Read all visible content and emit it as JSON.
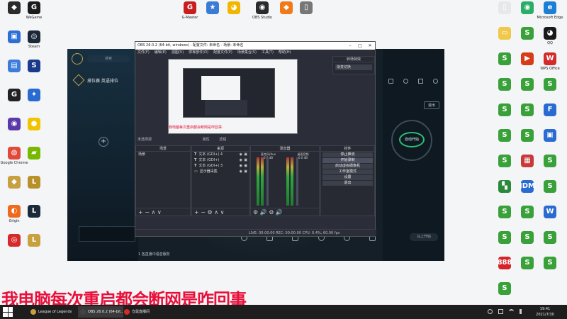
{
  "desktop": {
    "left_icons": [
      {
        "label": "",
        "color": "#2b2b2b",
        "glyph": "◆"
      },
      {
        "label": "WeGame",
        "color": "#1b1b1b",
        "glyph": "G"
      },
      {
        "label": "",
        "color": "#2c6fd6",
        "glyph": "▣"
      },
      {
        "label": "Steam",
        "color": "#1b2838",
        "glyph": "◎"
      },
      {
        "label": "",
        "color": "#3b7dd8",
        "glyph": "▤"
      },
      {
        "label": "",
        "color": "#1a3a8a",
        "glyph": "S"
      },
      {
        "label": "",
        "color": "#222222",
        "glyph": "G"
      },
      {
        "label": "",
        "color": "#2a6bd1",
        "glyph": "✦"
      },
      {
        "label": "",
        "color": "#5a3aa8",
        "glyph": "◉"
      },
      {
        "label": "",
        "color": "#f0c400",
        "glyph": "●"
      },
      {
        "label": "Google Chrome",
        "color": "#e04a3a",
        "glyph": "◍"
      },
      {
        "label": "",
        "color": "#76b900",
        "glyph": "▰"
      },
      {
        "label": "",
        "color": "#c8a040",
        "glyph": "◆"
      },
      {
        "label": "",
        "color": "#b8902a",
        "glyph": "L"
      },
      {
        "label": "Origin",
        "color": "#f06a1e",
        "glyph": "◐"
      },
      {
        "label": "",
        "color": "#1b2a3a",
        "glyph": "L"
      },
      {
        "label": "",
        "color": "#d42a2a",
        "glyph": "◎"
      },
      {
        "label": "",
        "color": "#c8a040",
        "glyph": "L"
      }
    ],
    "top_icons": [
      {
        "label": "G-Master",
        "color": "#c81e1e",
        "glyph": "G"
      },
      {
        "label": "",
        "color": "#3a7bd5",
        "glyph": "★"
      },
      {
        "label": "",
        "color": "#f2b600",
        "glyph": "◕"
      },
      {
        "label": "OBS Studio",
        "color": "#2b2b2b",
        "glyph": "◉"
      },
      {
        "label": "",
        "color": "#f07a1a",
        "glyph": "◆"
      },
      {
        "label": "",
        "color": "#777777",
        "glyph": "▯"
      }
    ],
    "right_icons": [
      {
        "label": "",
        "color": "#e8e8e8",
        "glyph": "▯"
      },
      {
        "label": "",
        "color": "#2aae67",
        "glyph": "◉"
      },
      {
        "label": "Microsoft Edge",
        "color": "#1b7fd6",
        "glyph": "e"
      },
      {
        "label": "",
        "color": "#f0c84a",
        "glyph": "▭"
      },
      {
        "label": "",
        "color": "#3aa13a",
        "glyph": "S"
      },
      {
        "label": "QQ",
        "color": "#1a1a1a",
        "glyph": "◕"
      },
      {
        "label": "",
        "color": "#3aa13a",
        "glyph": "S"
      },
      {
        "label": "",
        "color": "#d83a1a",
        "glyph": "▶"
      },
      {
        "label": "WPS Office",
        "color": "#d42a2a",
        "glyph": "W"
      },
      {
        "label": "",
        "color": "#3aa13a",
        "glyph": "S"
      },
      {
        "label": "",
        "color": "#3aa13a",
        "glyph": "S"
      },
      {
        "label": "",
        "color": "#3aa13a",
        "glyph": "S"
      },
      {
        "label": "",
        "color": "#3aa13a",
        "glyph": "S"
      },
      {
        "label": "",
        "color": "#3aa13a",
        "glyph": "S"
      },
      {
        "label": "",
        "color": "#2a6bd1",
        "glyph": "F"
      },
      {
        "label": "",
        "color": "#3aa13a",
        "glyph": "S"
      },
      {
        "label": "",
        "color": "#3aa13a",
        "glyph": "S"
      },
      {
        "label": "",
        "color": "#2a6bd1",
        "glyph": "▣"
      },
      {
        "label": "",
        "color": "#3aa13a",
        "glyph": "S"
      },
      {
        "label": "",
        "color": "#c83a3a",
        "glyph": "▦"
      },
      {
        "label": "",
        "color": "#3aa13a",
        "glyph": "S"
      },
      {
        "label": "",
        "color": "#2a8a3a",
        "glyph": "▚"
      },
      {
        "label": "",
        "color": "#2a6bd1",
        "glyph": "JDM"
      },
      {
        "label": "",
        "color": "#3aa13a",
        "glyph": "S"
      },
      {
        "label": "",
        "color": "#3aa13a",
        "glyph": "S"
      },
      {
        "label": "",
        "color": "#3aa13a",
        "glyph": "S"
      },
      {
        "label": "",
        "color": "#2a6bd1",
        "glyph": "W"
      },
      {
        "label": "",
        "color": "#3aa13a",
        "glyph": "S"
      },
      {
        "label": "",
        "color": "#3aa13a",
        "glyph": "S"
      },
      {
        "label": "",
        "color": "#3aa13a",
        "glyph": "S"
      },
      {
        "label": "",
        "color": "#d4242a",
        "glyph": "888"
      },
      {
        "label": "",
        "color": "#3aa13a",
        "glyph": "S"
      },
      {
        "label": "",
        "color": "#3aa13a",
        "glyph": "S"
      },
      {
        "label": "",
        "color": "#3aa13a",
        "glyph": "S"
      }
    ]
  },
  "game_client": {
    "search_placeholder": "搜索",
    "mode_title": "排位赛 英语排位",
    "exit_label": "退出",
    "start_label": "自动开始",
    "bottom_hint": "1 各直播中语音服务",
    "bottom_left_buttons": [
      "",
      "",
      ""
    ],
    "bottom_actions": [
      "直播间",
      "",
      "",
      "",
      "",
      ""
    ],
    "right_action": "马上开始"
  },
  "obs": {
    "window_title": "OBS 26.0.2 (64-bit, windows) - 配置文件: 未命名 - 场景: 未命名",
    "menu": [
      "文件(F)",
      "编辑(E)",
      "视图(V)",
      "停靠部件(D)",
      "配置文件(P)",
      "场景集合(S)",
      "工具(T)",
      "帮助(H)"
    ],
    "transition_title": "转场特效",
    "transition_value": "渐变切换",
    "preview_caption": "我电脑每次重启都会断网是咋回事",
    "source_name": "未选择源",
    "properties_label": "属性",
    "filters_label": "滤镜",
    "docks": {
      "scenes_title": "场景",
      "sources_title": "来源",
      "mixer_title": "混音器",
      "controls_title": "控件"
    },
    "scenes": [
      "场景"
    ],
    "sources": [
      {
        "icon": "T",
        "name": "文本 (GDI+) 4"
      },
      {
        "icon": "T",
        "name": "文本 (GDI+)"
      },
      {
        "icon": "T",
        "name": "文本 (GDI+) 3"
      },
      {
        "icon": "▭",
        "name": "显示器采集"
      }
    ],
    "mixer_channels": [
      {
        "name": "麦克风/Aux",
        "db": "0.0 dB"
      },
      {
        "name": "桌面音频",
        "db": "0.0 dB"
      }
    ],
    "controls": [
      "停止推流",
      "开始录制",
      "启动虚拟摄像机",
      "工作室模式",
      "设置",
      "退出"
    ],
    "status": "LIVE: 00:00:00   REC: 00:00:00   CPU: 0.4%, 60.00 fps"
  },
  "taskbar": {
    "apps": [
      {
        "label": "League of Legends",
        "color": "#c8a040"
      },
      {
        "label": "OBS 26.0.2 (64-bit...)",
        "color": "#444444"
      },
      {
        "label": "仓鼠直播间",
        "color": "#d42a2a"
      }
    ],
    "time": "19:41",
    "date": "2021/7/30"
  },
  "overlay": {
    "text": "我电脑每次重启都会断网是咋回事"
  }
}
